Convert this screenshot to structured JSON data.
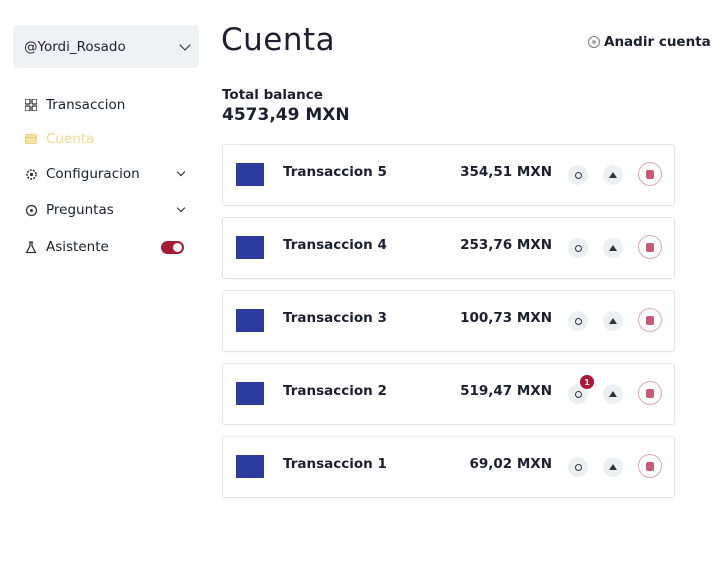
{
  "sidebar": {
    "account": "@Yordi_Rosado",
    "items": [
      {
        "label": "Transaccion",
        "icon": "grid-icon"
      },
      {
        "label": "Cuenta",
        "icon": "wallet-icon"
      },
      {
        "label": "Configuracion",
        "icon": "gear-icon"
      },
      {
        "label": "Preguntas",
        "icon": "question-icon"
      },
      {
        "label": "Asistente",
        "icon": "flask-icon"
      }
    ],
    "active_item": "Cuenta",
    "assistant_toggle": "on"
  },
  "header": {
    "title": "Cuenta",
    "add_account": "Anadir cuenta"
  },
  "balance": {
    "label": "Total balance",
    "value": "4573,49 MXN"
  },
  "transactions": [
    {
      "name": "Transaccion 5",
      "amount": "354,51 MXN"
    },
    {
      "name": "Transaccion 4",
      "amount": "253,76 MXN"
    },
    {
      "name": "Transaccion 3",
      "amount": "100,73 MXN"
    },
    {
      "name": "Transaccion 2",
      "amount": "519,47 MXN",
      "badge": "1"
    },
    {
      "name": "Transaccion 1",
      "amount": "69,02 MXN"
    }
  ],
  "colors": {
    "accent": "#a61a36",
    "active_nav": "#f0d98a",
    "thumbnail": "#2c3b9e"
  }
}
